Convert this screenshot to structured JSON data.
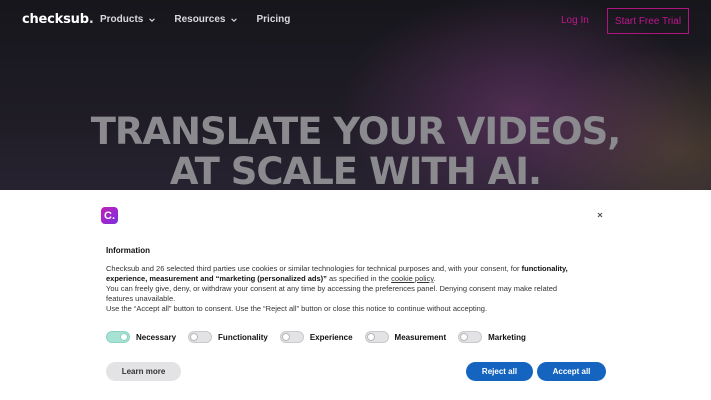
{
  "header": {
    "logo_text": "checksub",
    "logo_dot": ".",
    "nav": [
      {
        "label": "Products",
        "icon": "chevron-down-icon"
      },
      {
        "label": "Resources",
        "icon": "chevron-down-icon"
      },
      {
        "label": "Pricing"
      }
    ],
    "login": "Log In",
    "cta": "Start Free Trial",
    "accent": "#c0168e"
  },
  "hero": {
    "headline_line1": "TRANSLATE YOUR VIDEOS,",
    "headline_line2": "AT SCALE WITH AI."
  },
  "consent": {
    "brand_badge": "C.",
    "title": "Information",
    "text1_before": "Checksub and 26 selected third parties use cookies or similar technologies for technical purposes and, with your consent, for ",
    "text1_bold": "functionality, experience, measurement and “marketing (personalized ads)”",
    "text1_middle": " as specified in the ",
    "cookie_link": "cookie policy",
    "text1_end": ".",
    "text2": "You can freely give, deny, or withdraw your consent at any time by accessing the preferences panel. Denying consent may make related features unavailable.",
    "text3": "Use the “Accept all” button to consent. Use the “Reject all” button or close this notice to continue without accepting.",
    "toggles": [
      {
        "label": "Necessary",
        "on": true
      },
      {
        "label": "Functionality",
        "on": false
      },
      {
        "label": "Experience",
        "on": false
      },
      {
        "label": "Measurement",
        "on": false
      },
      {
        "label": "Marketing",
        "on": false
      }
    ],
    "learn_more": "Learn more",
    "reject_all": "Reject all",
    "accept_all": "Accept all",
    "button_color": "#1565c0"
  }
}
